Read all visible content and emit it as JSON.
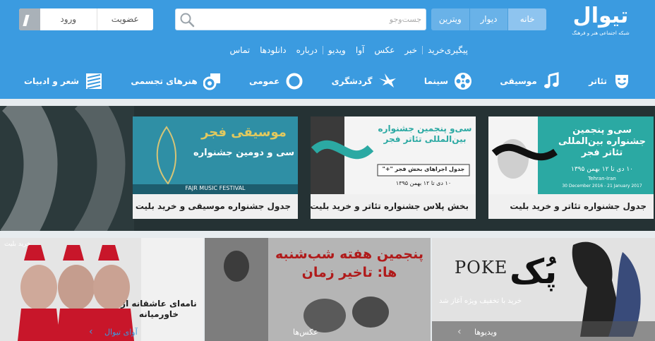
{
  "brand": {
    "name": "تیوال",
    "tagline": "شبکه اجتماعی هنر و فرهنگ"
  },
  "top_tabs": [
    "خانه",
    "دیوار",
    "ویترین"
  ],
  "search": {
    "placeholder": "جست‌وجو"
  },
  "account": {
    "signup": "عضویت",
    "login": "ورود"
  },
  "sub_links": [
    "پیگیری‌خرید",
    "خبر",
    "عکس",
    "آوا",
    "ویدیو",
    "درباره",
    "دانلودها",
    "تماس"
  ],
  "categories": [
    {
      "label": "تئاتر",
      "icon": "theater-masks-icon"
    },
    {
      "label": "موسیقی",
      "icon": "music-note-icon"
    },
    {
      "label": "سینما",
      "icon": "film-reel-icon"
    },
    {
      "label": "گردشگری",
      "icon": "bird-icon"
    },
    {
      "label": "عمومی",
      "icon": "circle-icon"
    },
    {
      "label": "هنرهای تجسمی",
      "icon": "shapes-icon"
    },
    {
      "label": "شعر و ادبیات",
      "icon": "book-icon"
    }
  ],
  "featured": [
    {
      "caption": "جدول جشنواره تئاتر و خرید بلیت",
      "poster_title": "سی‌و پنجمین جشنواره بین‌المللی تئاتر فجر",
      "poster_dates": "۱۰ دی تا ۱۲ بهمن ۱۳۹۵",
      "poster_city": "Tehran-Iran",
      "poster_dates_en": "30 December 2016 - 21 January 2017"
    },
    {
      "caption": "بخش پلاس جشنواره تئاتر و خرید بلیت",
      "poster_title": "سی‌و پنجمین جشنواره بین‌المللی تئاتر فجر",
      "poster_sub": "جدول اجراهای بخش فجر \"+\"",
      "poster_dates": "۱۰ دی تا ۱۲ بهمن ۱۳۹۵"
    },
    {
      "caption": "جدول جشنواره موسیقی و خرید بلیت",
      "poster_title": "موسیقی فجر",
      "poster_sub": "سی و دومین جشنواره",
      "poster_en": "FAJR MUSIC FESTIVAL"
    }
  ],
  "tiles": [
    {
      "label": "ویدیوها",
      "overlay": "خرید با تخفیف ویژه آغاز شد",
      "poster_en": "POKE",
      "poster_fa": "پُک"
    },
    {
      "label": "عکس‌ها",
      "poster_fa": "پنجمین هفته شب‌شنبه ها: تاخیر زمان"
    },
    {
      "label": "آوای تیوال",
      "overlay": "خرید بلیت",
      "poster_fa": "نامه‌ای عاشقانه از خاورمیانه"
    }
  ],
  "colors": {
    "header": "#3b9be0",
    "band": "#253234",
    "teal": "#2ba9a3"
  }
}
